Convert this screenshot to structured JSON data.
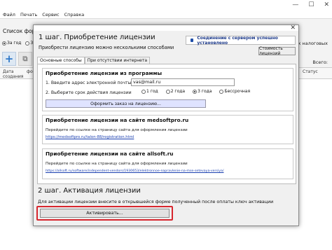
{
  "main_window": {
    "menu": [
      "Файл",
      "Печать",
      "Сервис",
      "Справка"
    ],
    "section_title": "Список форм",
    "radios": [
      {
        "label": "За год",
        "selected": true
      },
      {
        "label": "За",
        "selected": false
      }
    ],
    "right_label_top": "всех налоговых",
    "right_label_all": "Всего:",
    "grid_headers": {
      "date": "Дата\nсоздания",
      "col2": "фо",
      "status": "Статус"
    }
  },
  "dialog": {
    "step1_title": "1 шаг. Приобретение лицензии",
    "subtitle": "Приобрести лицензию можно несколькими способами",
    "connection_status": "Соединение с сервером успешно установлено",
    "cost_button": "Стоимость лицензий",
    "tabs": [
      "Основные способы",
      "При отсутствии интернета"
    ],
    "program_group": {
      "title": "Приобретение лицензии из программы",
      "email_label": "1. Введите адрес электронной почты",
      "email_value": "vas@mail.ru",
      "period_label": "2. Выберите срок действия лицензии",
      "periods": [
        {
          "label": "1 год",
          "selected": false
        },
        {
          "label": "2 года",
          "selected": false
        },
        {
          "label": "3 года",
          "selected": true
        },
        {
          "label": "Бессрочная",
          "selected": false
        }
      ],
      "order_button": "Оформить заказ на лицензию..."
    },
    "medsoft_group": {
      "title": "Приобретение лицензии на сайте medsoftpro.ru",
      "text": "Перейдите по ссылке на страницу сайта для оформления лицензии",
      "link": "https://medsoftpro.ru/talon-88/registration.html"
    },
    "allsoft_group": {
      "title": "Приобретение лицензии на сайте allsoft.ru",
      "text": "Перейдите по ссылке на страницу сайта для оформления лицензии",
      "link": "https://allsoft.ru/software/independent-vendors/1930653/elektronnoe-napravlenie-na-mse-setevaya-versiya/"
    },
    "step2_title": "2 шаг. Активация лицензии",
    "step2_text": "Для активации лицензии внесите в открывшейся форме полученный после оплаты ключ активации",
    "activate_button": "Активировать...",
    "highlight_color": "#d7262e"
  }
}
